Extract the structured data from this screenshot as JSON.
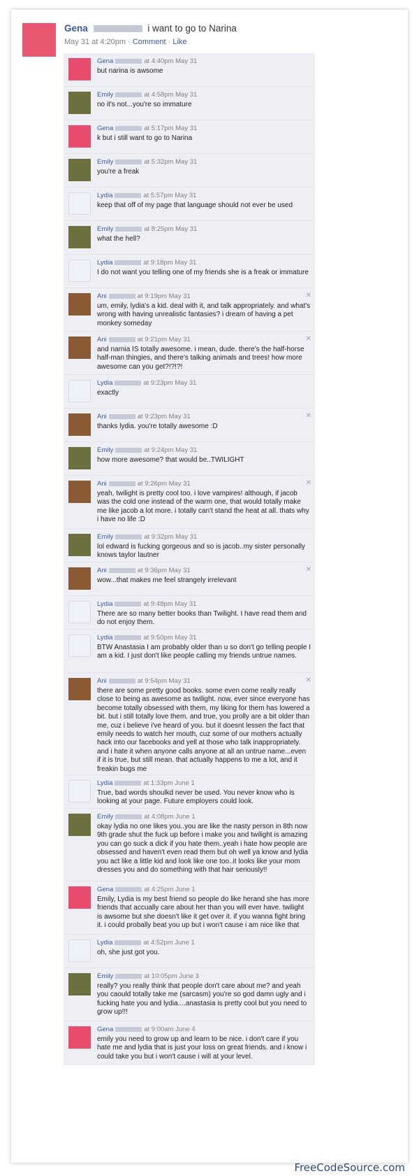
{
  "post": {
    "author": "Gena",
    "text": "i want to go to Narina",
    "time": "May 31 at 4:20pm",
    "sep": "·",
    "comment_link": "Comment",
    "like_link": "Like",
    "avatar_color": "#e8576f"
  },
  "comments": [
    {
      "author": "Gena",
      "time": "at 4:40pm May 31",
      "text": "but narina is awsome",
      "avatar": "gena",
      "close": false
    },
    {
      "author": "Emily",
      "time": "at 4:58pm May 31",
      "text": "no it's not...you're so immature",
      "avatar": "emily",
      "close": false
    },
    {
      "author": "Gena",
      "time": "at 5:17pm May 31",
      "text": "k but i still want to go to Narina",
      "avatar": "gena",
      "close": false
    },
    {
      "author": "Emily",
      "time": "at 5:32pm May 31",
      "text": "you're a freak",
      "avatar": "emily",
      "close": false
    },
    {
      "author": "Lydia",
      "time": "at 5:57pm May 31",
      "text": "keep that off of my page that language should not ever be used",
      "avatar": "lydia",
      "close": false
    },
    {
      "author": "Emily",
      "time": "at 8:25pm May 31",
      "text": "what the hell?",
      "avatar": "emily",
      "close": false
    },
    {
      "author": "Lydia",
      "time": "at 9:18pm May 31",
      "text": "I do not want you telling one of my friends she is a freak or immature",
      "avatar": "lydia",
      "close": false
    },
    {
      "author": "Ani",
      "time": "at 9:19pm May 31",
      "text": "um, emily, lydia's a kid. deal with it, and talk appropriately. and what's wrong with having unrealistic fantasies? i dream of having a pet monkey someday",
      "avatar": "ani",
      "close": true
    },
    {
      "author": "Ani",
      "time": "at 9:21pm May 31",
      "text": "and narnia IS totally awesome. i mean, dude. there's the half-horse half-man thingies, and there's talking animals and trees! how more awesome can you get?!?!?!",
      "avatar": "ani",
      "close": true
    },
    {
      "author": "Lydia",
      "time": "at 9:23pm May 31",
      "text": "exactly",
      "avatar": "lydia",
      "close": false
    },
    {
      "author": "Ani",
      "time": "at 9:23pm May 31",
      "text": "thanks lydia. you're totally awesome :D",
      "avatar": "ani",
      "close": true
    },
    {
      "author": "Emily",
      "time": "at 9:24pm May 31",
      "text": "how more awesome? that would be..TWILIGHT",
      "avatar": "emily",
      "close": false
    },
    {
      "author": "Ani",
      "time": "at 9:26pm May 31",
      "text": "yeah, twilight is pretty cool too. i love vampires! although, if jacob was the cold one instead of the warm one, that would totally make me like jacob a lot more. i totally can't stand the heat at all. thats why i have no life :D",
      "avatar": "ani",
      "close": true
    },
    {
      "author": "Emily",
      "time": "at 9:32pm May 31",
      "text": "lol edward is fucking gorgeous and so is jacob..my sister personally knows taylor lautner",
      "avatar": "emily",
      "close": false
    },
    {
      "author": "Ani",
      "time": "at 9:36pm May 31",
      "text": "wow...that makes me feel strangely irrelevant",
      "avatar": "ani",
      "close": true
    },
    {
      "author": "Lydia",
      "time": "at 9:48pm May 31",
      "text": "There are so many better books than Twilight. I have read them and do not enjoy them.",
      "avatar": "lydia",
      "close": false
    },
    {
      "author": "Lydia",
      "time": "at 9:50pm May 31",
      "text": "BTW Anastasia I am probably older than u so don't go telling people I am a kid. I just don't like people calling my friends untrue names.",
      "avatar": "lydia",
      "close": false
    },
    {
      "author": "Ani",
      "time": "at 9:54pm May 31",
      "text": "there are some pretty good books. some even come really really close to being as awesome as twilight. now, ever since everyone has become totally obsessed with them, my liking for them has lowered a bit. but i still totally love them. and true, you prolly are a bit older than me, cuz i believe i've heard of you. but it doesnt lessen the fact that emily needs to watch her mouth, cuz some of our mothers actually hack into our facebooks and yell at those who talk inappropriately. and i hate it when anyone calls anyone at all an untrue name...even if it is true, but still mean. that actually happens to me a lot, and it freakin bugs me",
      "avatar": "ani",
      "close": true
    },
    {
      "author": "Lydia",
      "time": "at 1:33pm June 1",
      "text": "True, bad words shoulkd never be used. You never know who is looking at your page. Future employers could look.",
      "avatar": "lydia",
      "close": false
    },
    {
      "author": "Emily",
      "time": "at 4:08pm June 1",
      "text": "okay lydia no one likes you..you are like the nasty person in 8th now 9th grade shut the fuck up before i make you and twilight is amazing you can go suck a dick if you hate them..yeah i hate how people are obsessed and haven't even read them but oh well ya know and lydia you act like a little kid and look like one too..it looks like your mom dresses you and do something with that hair seriously!!",
      "avatar": "emily",
      "close": false
    },
    {
      "author": "Gena",
      "time": "at 4:25pm June 1",
      "text": "Emily, Lydia is my best friend so people do like herand she has more friends that accually care about her than you will ever have. twilight is awsome but she doesn't like it get over it. if you wanna fight bring it. i could probally beat you up but i won't cause i am nice like that",
      "avatar": "gena",
      "close": false
    },
    {
      "author": "Lydia",
      "time": "at 4:52pm June 1",
      "text": "oh, she just got you.",
      "avatar": "lydia",
      "close": false
    },
    {
      "author": "Emily",
      "time": "at 10:05pm June 3",
      "text": "really? you really think that people don't care about me? and yeah you caould totally take me (sarcasm) you're so god damn ugly and i fucking hate you and lydia....anastasia is pretty cool but you need to grow up!!!",
      "avatar": "emily",
      "close": false
    },
    {
      "author": "Gena",
      "time": "at 9:00am June 4",
      "text": "emily you need to grow up and learn to be nice. i don't care if you hate me and lydia that is just your loss on great friends. and i know i could take you but i won't cause i will at your level.",
      "avatar": "gena",
      "close": false
    }
  ],
  "close_glyph": "✕",
  "watermark": "FreeCodeSource.com"
}
